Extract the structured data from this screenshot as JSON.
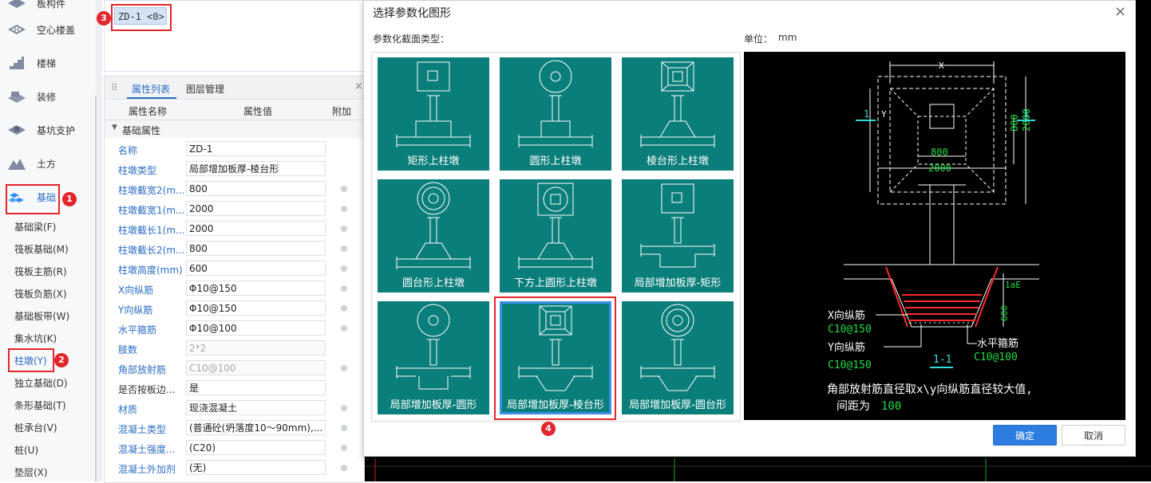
{
  "nav": {
    "items": [
      {
        "label": "板构件",
        "icon": "slab-icon"
      },
      {
        "label": "空心楼盖",
        "icon": "hollow-floor-icon"
      },
      {
        "label": "楼梯",
        "icon": "stairs-icon"
      },
      {
        "label": "装修",
        "icon": "decoration-icon"
      },
      {
        "label": "基坑支护",
        "icon": "pit-support-icon"
      },
      {
        "label": "土方",
        "icon": "earthwork-icon"
      },
      {
        "label": "基础",
        "icon": "foundation-icon"
      }
    ],
    "subitems": [
      "基础梁(F)",
      "筏板基础(M)",
      "筏板主筋(R)",
      "筏板负筋(X)",
      "基础板带(W)",
      "集水坑(K)",
      "柱墩(Y)",
      "独立基础(D)",
      "条形基础(T)",
      "桩承台(V)",
      "桩(U)",
      "垫层(X)"
    ],
    "badges": [
      "1",
      "2",
      "3",
      "4"
    ]
  },
  "component_list": {
    "selected": "ZD-1 <0>"
  },
  "props": {
    "tabs": [
      "属性列表",
      "图层管理"
    ],
    "columns": [
      "属性名称",
      "属性值",
      "附加"
    ],
    "group": "基础属性",
    "rows": [
      {
        "name": "名称",
        "value": "ZD-1"
      },
      {
        "name": "柱墩类型",
        "value": "局部增加板厚-棱台形"
      },
      {
        "name": "柱墩截宽2(m...",
        "value": "800"
      },
      {
        "name": "柱墩截宽1(m...",
        "value": "2000"
      },
      {
        "name": "柱墩截长1(m...",
        "value": "2000"
      },
      {
        "name": "柱墩截长2(m...",
        "value": "800"
      },
      {
        "name": "柱墩高度(mm)",
        "value": "600"
      },
      {
        "name": "X向纵筋",
        "value": "Φ10@150"
      },
      {
        "name": "Y向纵筋",
        "value": "Φ10@150"
      },
      {
        "name": "水平箍筋",
        "value": "Φ10@100"
      },
      {
        "name": "肢数",
        "value": "2*2"
      },
      {
        "name": "角部放射筋",
        "value": "C10@100"
      },
      {
        "name": "是否按板边...",
        "value": "是"
      },
      {
        "name": "材质",
        "value": "现浇混凝土"
      },
      {
        "name": "混凝土类型",
        "value": "(普通砼(坍落度10～90mm),..."
      },
      {
        "name": "混凝土强度...",
        "value": "(C20)"
      },
      {
        "name": "混凝土外加剂",
        "value": "(无)"
      }
    ]
  },
  "dialog": {
    "title": "选择参数化图形",
    "close": "×",
    "section_label": "参数化截面类型：",
    "unit_label": "单位：",
    "unit_value": "mm",
    "shapes": [
      "矩形上柱墩",
      "圆形上柱墩",
      "棱台形上柱墩",
      "圆台形上柱墩",
      "下方上圆形上柱墩",
      "局部增加板厚-矩形",
      "局部增加板厚-圆形",
      "局部增加板厚-棱台形",
      "局部增加板厚-圆台形"
    ],
    "selected_index": 7,
    "ok": "确定",
    "cancel": "取消"
  },
  "preview": {
    "dim_x": "X",
    "dim_y": "Y",
    "dim_800_top": "800",
    "dim_2000_right": "2000",
    "dim_800_bottom": "800",
    "dim_2000_bottom": "2000",
    "section_mark": "1",
    "lae": "1aE",
    "height": "600",
    "x_rebar_label": "X向纵筋",
    "x_rebar_value": "C10@150",
    "y_rebar_label": "Y向纵筋",
    "y_rebar_value": "C10@150",
    "stirrup_label": "水平箍筋",
    "stirrup_value": "C10@100",
    "section_title": "1-1",
    "note1": "角部放射筋直径取x\\y向纵筋直径较大值,",
    "note2": "间距为",
    "note_value": "100",
    "colors": {
      "cad_white": "#ffffff",
      "cad_green": "#22dd44",
      "cad_red": "#ff2a2a",
      "cad_cyan": "#33dddd"
    }
  }
}
